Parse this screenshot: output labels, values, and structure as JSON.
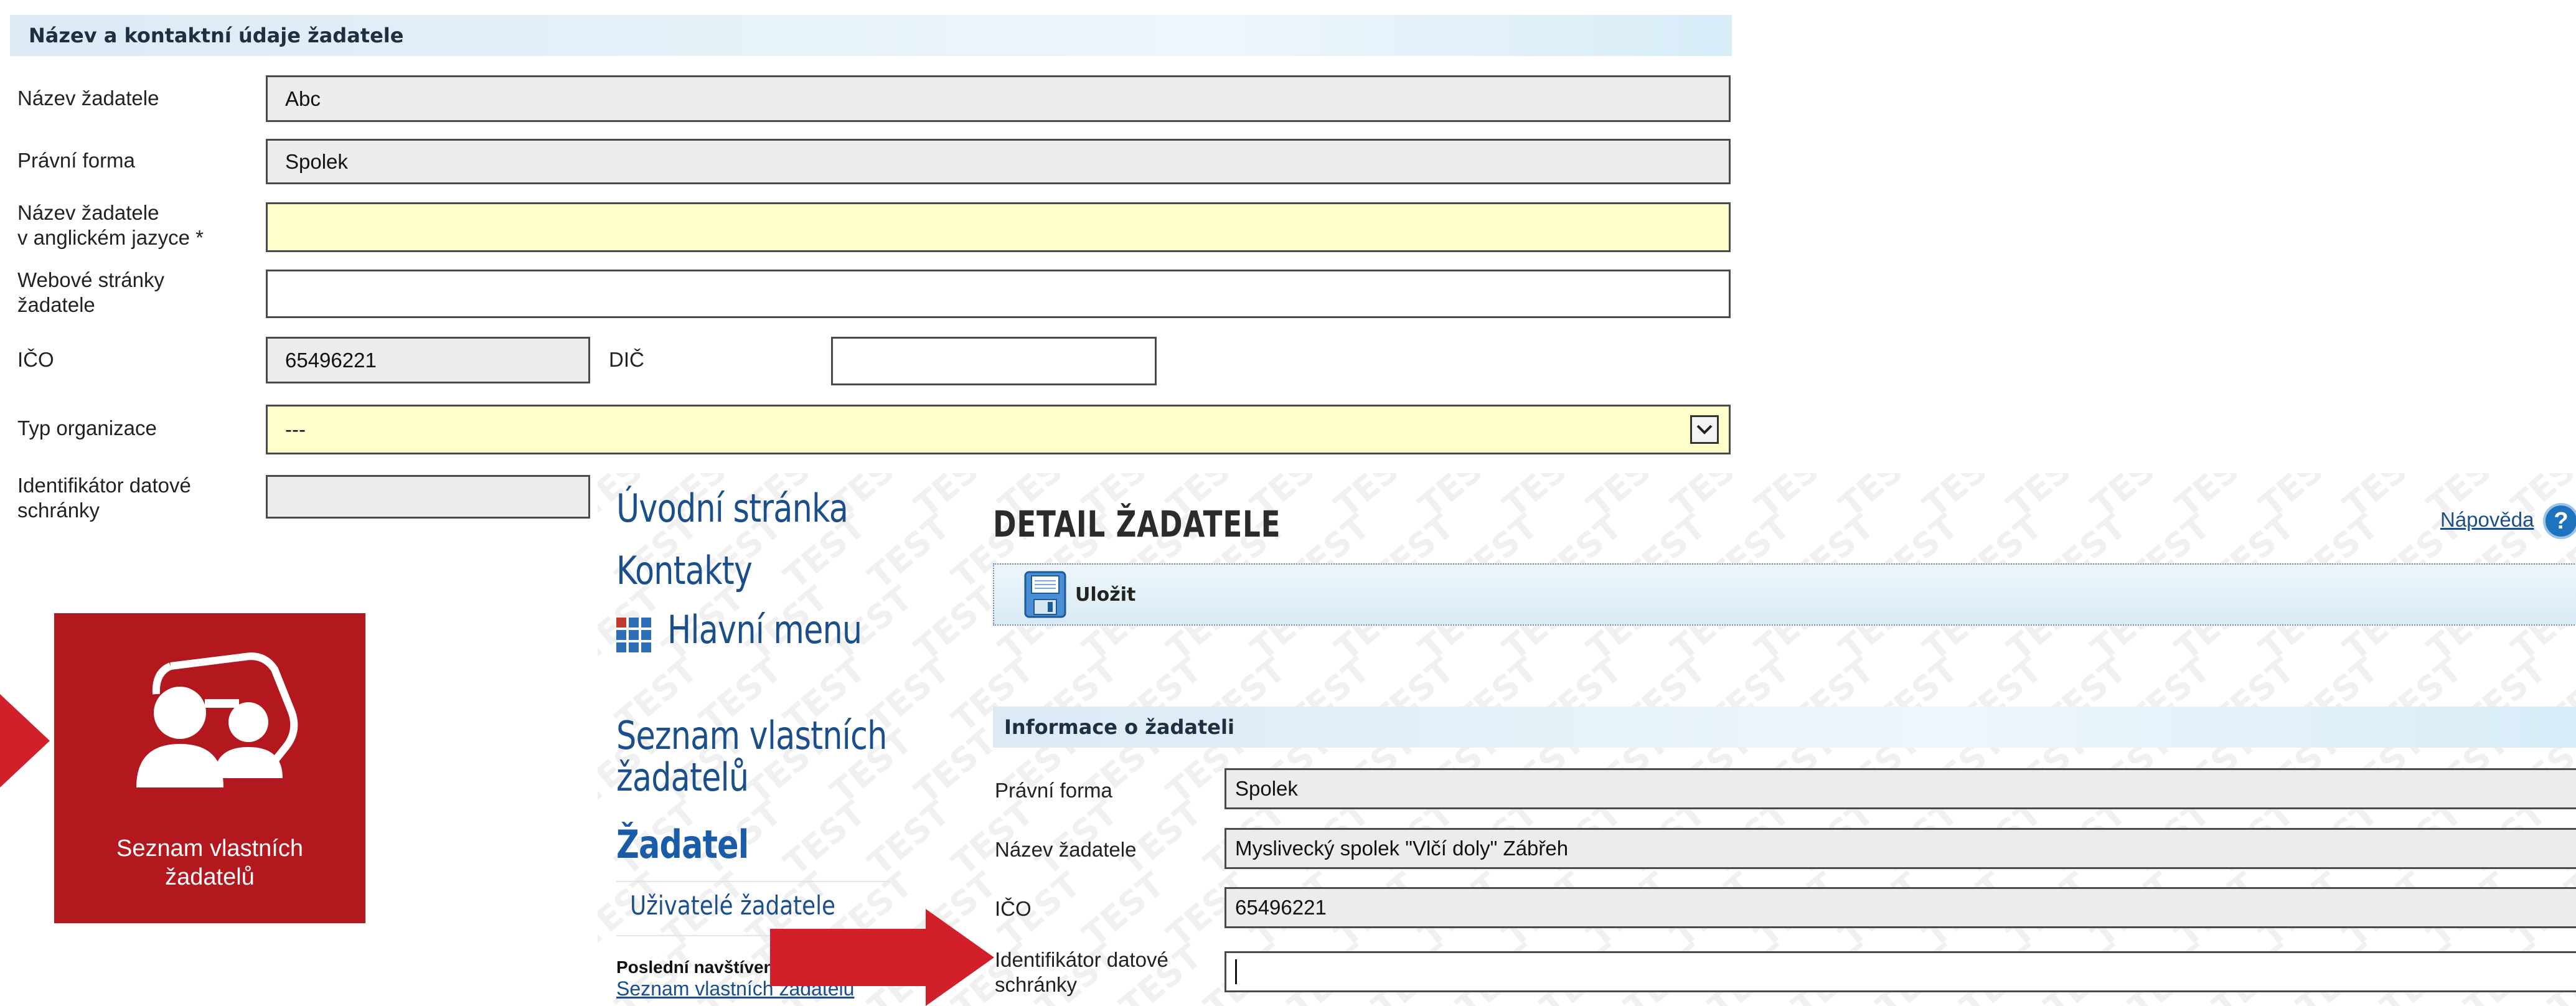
{
  "top_form": {
    "section_title": "Název a kontaktní údaje žadatele",
    "fields": {
      "nazev_label": "Název žadatele",
      "nazev_value": "Abc",
      "pravni_forma_label": "Právní forma",
      "pravni_forma_value": "Spolek",
      "nazev_en_label_1": "Název žadatele",
      "nazev_en_label_2": "v anglickém jazyce *",
      "nazev_en_value": "",
      "web_label_1": "Webové stránky",
      "web_label_2": "žadatele",
      "web_value": "",
      "ico_label": "IČO",
      "ico_value": "65496221",
      "dic_label": "DIČ",
      "dic_value": "",
      "typ_org_label": "Typ organizace",
      "typ_org_value": "---",
      "ids_label_1": "Identifikátor datové",
      "ids_label_2": "schránky",
      "ids_value": ""
    }
  },
  "tile": {
    "label_1": "Seznam vlastních",
    "label_2": "žadatelů",
    "icon": "users-group-icon",
    "color": "#b2181d"
  },
  "app": {
    "nav": {
      "home": "Úvodní stránka",
      "contacts": "Kontakty",
      "main_menu": "Hlavní menu",
      "own_applicants_1": "Seznam vlastních",
      "own_applicants_2": "žadatelů",
      "applicant": "Žadatel",
      "applicant_users": "Uživatelé žadatele"
    },
    "recent": {
      "heading": "Poslední navštíven",
      "link": "Seznam vlastních žadatelů"
    },
    "watermark_text": "TEST",
    "page_title": "DETAIL ŽADATELE",
    "help_label": "Nápověda",
    "toolbar": {
      "save_label": "Uložit"
    },
    "info": {
      "section_title": "Informace o žadateli",
      "pravni_forma_label": "Právní forma",
      "pravni_forma_value": "Spolek",
      "nazev_label": "Název žadatele",
      "nazev_value": "Myslivecký spolek \"Vlčí doly\" Zábřeh",
      "ico_label": "IČO",
      "ico_value": "65496221",
      "ids_label_1": "Identifikátor datové",
      "ids_label_2": "schránky",
      "ids_value": ""
    }
  }
}
